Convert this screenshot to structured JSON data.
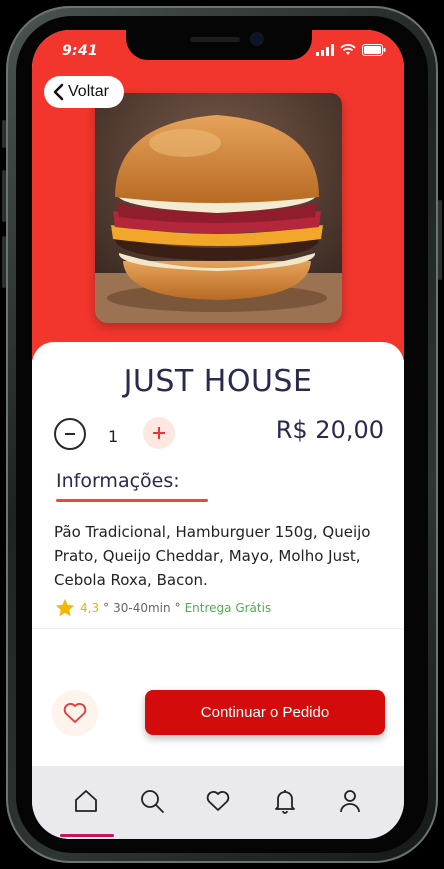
{
  "status_bar": {
    "time": "9:41"
  },
  "header": {
    "back_label": "Voltar"
  },
  "product": {
    "name": "JUST HOUSE",
    "quantity": "1",
    "price": "R$ 20,00",
    "info_heading": "Informações:",
    "description": "Pão Tradicional, Hamburguer 150g, Queijo Prato, Queijo Cheddar, Mayo, Molho Just, Cebola Roxa, Bacon.",
    "rating": "4,3",
    "sep1": "°",
    "delivery_time": "30-40min",
    "sep2": "°",
    "delivery_fee": "Entrega Grátis"
  },
  "actions": {
    "continue_label": "Continuar o Pedido"
  },
  "tab_bar": {
    "items": [
      {
        "icon": "home-icon"
      },
      {
        "icon": "search-icon"
      },
      {
        "icon": "heart-icon"
      },
      {
        "icon": "bell-icon"
      },
      {
        "icon": "user-icon"
      }
    ]
  },
  "colors": {
    "accent": "#f2362d",
    "button": "#d40b0b",
    "title": "#2a2a4e"
  }
}
